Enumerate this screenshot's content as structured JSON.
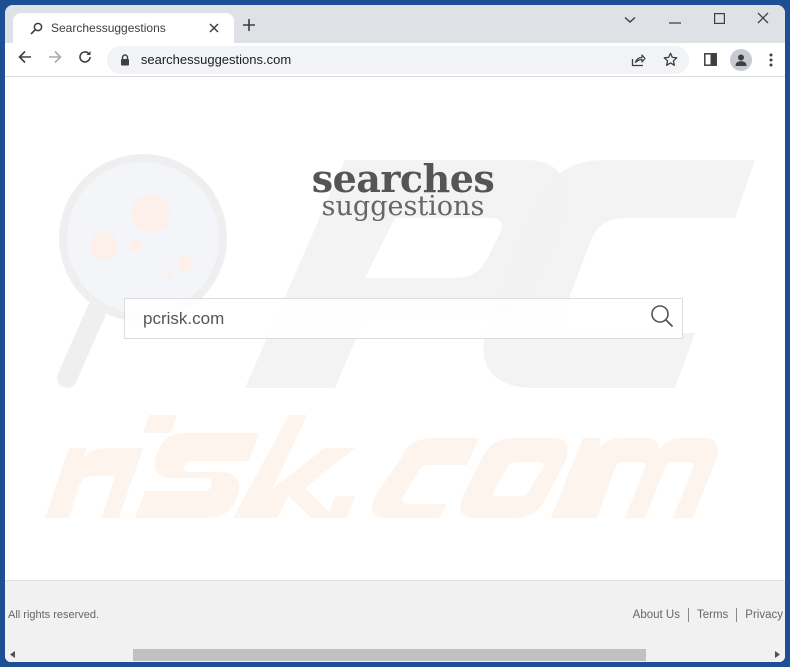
{
  "browser": {
    "tab": {
      "title": "Searchessuggestions",
      "favicon": "search-icon",
      "close_icon": "close-icon"
    },
    "new_tab_icon": "plus-icon",
    "window_controls": [
      "tab-search-chevron",
      "minimize",
      "maximize",
      "close"
    ],
    "toolbar": {
      "back_icon": "arrow-left-icon",
      "forward_icon": "arrow-right-icon",
      "reload_icon": "reload-icon",
      "lock_icon": "lock-icon",
      "url": "searchessuggestions.com",
      "share_icon": "share-icon",
      "bookmark_icon": "star-icon",
      "side_panel_icon": "side-panel-icon",
      "profile_icon": "person-icon",
      "menu_icon": "kebab-menu-icon"
    }
  },
  "page": {
    "logo": {
      "line1": "searches",
      "line2": "suggestions"
    },
    "search": {
      "value": "pcrisk.com",
      "placeholder": "",
      "button_icon": "search-icon"
    },
    "footer": {
      "copyright": "All rights reserved.",
      "links": [
        {
          "label": "About Us"
        },
        {
          "label": "Terms"
        },
        {
          "label": "Privacy"
        }
      ]
    },
    "watermark": {
      "text_top": "PC",
      "text_bottom": "risk.com",
      "accent_color": "#f47b20"
    }
  },
  "colors": {
    "window_frame": "#1c4f93",
    "tabstrip": "#dee1e6",
    "omnibox": "#f1f3f4",
    "footer_bg": "#f1f1f1",
    "logo_text": "#555555"
  }
}
